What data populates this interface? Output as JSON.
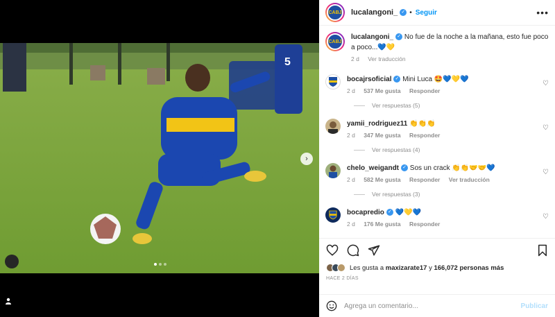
{
  "post": {
    "author": "lucalangoni_",
    "follow_label": "Seguir",
    "more_label": "•••",
    "caption": "No fue de la noche a la mañana, esto fue poco a poco...💙💛",
    "caption_age": "2 d",
    "caption_translate": "Ver traducción",
    "photo_carousel": {
      "total_slides": 3,
      "active_slide": 1
    }
  },
  "comments": [
    {
      "user": "bocajrsoficial",
      "verified": true,
      "text": "Mini Luca 🤩💙💛💙",
      "age": "2 d",
      "likes": "537 Me gusta",
      "reply": "Responder",
      "translate": "",
      "replies": "Ver respuestas (5)"
    },
    {
      "user": "yamii_rodriguez11",
      "verified": false,
      "text": "👏👏👏",
      "age": "2 d",
      "likes": "347 Me gusta",
      "reply": "Responder",
      "translate": "",
      "replies": "Ver respuestas (4)"
    },
    {
      "user": "chelo_weigandt",
      "verified": true,
      "text": "Sos un crack 👏👏🤝🤝💙",
      "age": "2 d",
      "likes": "582 Me gusta",
      "reply": "Responder",
      "translate": "Ver traducción",
      "replies": "Ver respuestas (3)"
    },
    {
      "user": "bocapredio",
      "verified": true,
      "text": "💙💛💙",
      "age": "2 d",
      "likes": "176 Me gusta",
      "reply": "Responder",
      "translate": "",
      "replies": ""
    }
  ],
  "likes": {
    "prefix": "Les gusta a",
    "user": "maxizarate17",
    "connector": "y",
    "others": "166,072 personas más"
  },
  "time_ago": "HACE 2 DÍAS",
  "add_comment": {
    "placeholder": "Agrega un comentario...",
    "publish": "Publicar"
  },
  "colors": {
    "accent": "#0095f6",
    "boca_blue": "#1e4fa3",
    "boca_gold": "#f5c400"
  }
}
